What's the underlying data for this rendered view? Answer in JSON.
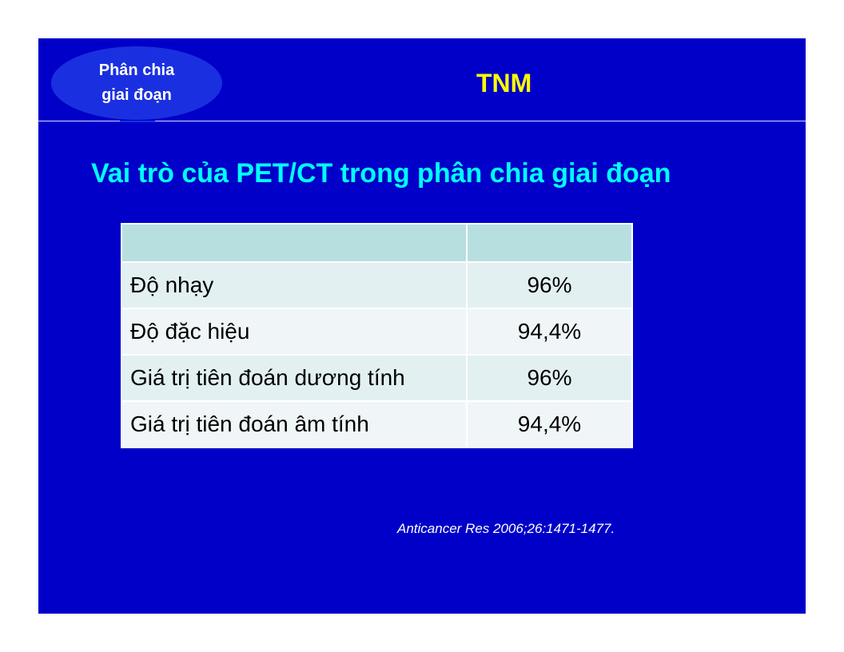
{
  "badge": {
    "label": "Phân chia\ngiai đoạn"
  },
  "section_tag": "TNM",
  "heading": "Vai trò của PET/CT trong phân chia giai đoạn",
  "table": {
    "header": [
      "",
      ""
    ],
    "rows": [
      {
        "metric": "Độ nhạy",
        "value": "96%"
      },
      {
        "metric": "Độ đặc hiệu",
        "value": "94,4%"
      },
      {
        "metric": "Giá trị tiên đoán dương tính",
        "value": "96%"
      },
      {
        "metric": "Giá trị tiên đoán âm tính",
        "value": "94,4%"
      }
    ]
  },
  "citation": "Anticancer Res 2006;26:1471-1477.",
  "colors": {
    "slide_background": "#0000c8",
    "badge": "#1a30e0",
    "tag": "#ffff00",
    "heading": "#00ffff",
    "table_header": "#b8dfe0"
  }
}
